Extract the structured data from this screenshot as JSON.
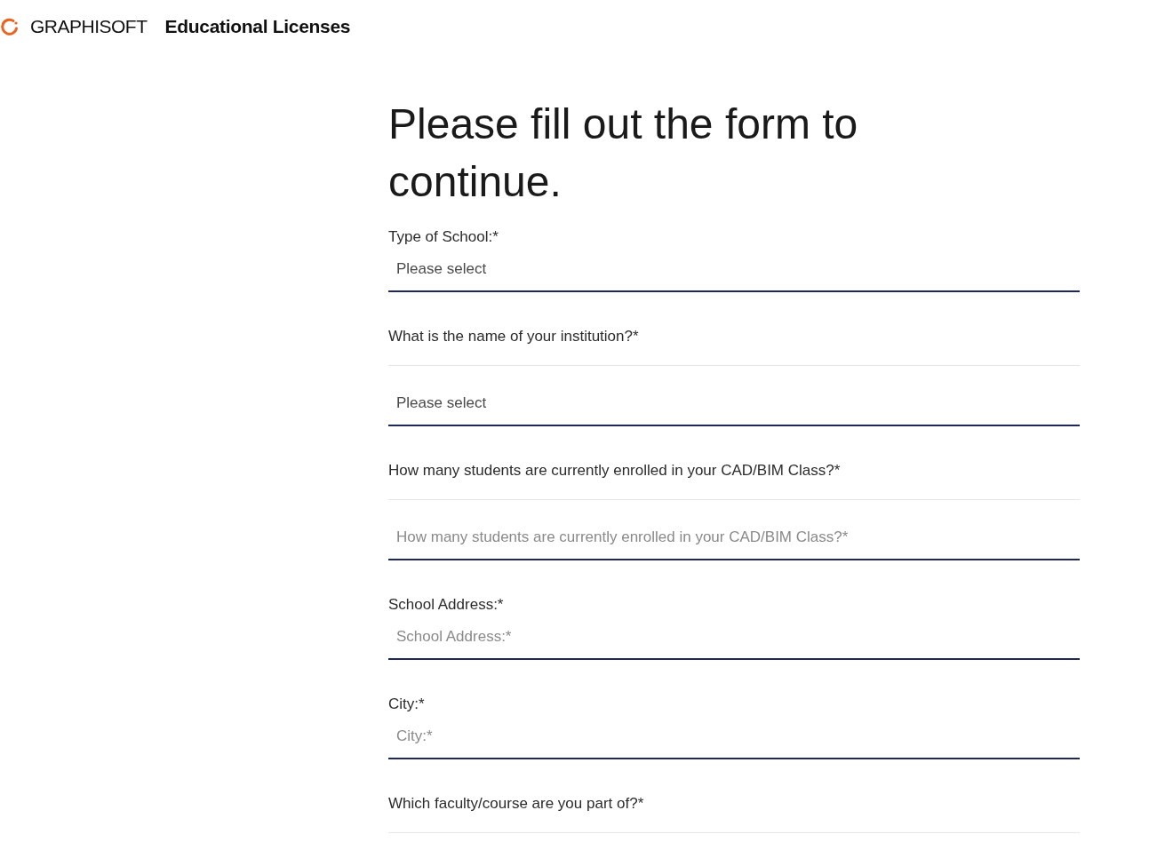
{
  "header": {
    "brand": "GRAPHISOFT",
    "title": "Educational Licenses"
  },
  "form": {
    "heading": "Please fill out the form to continue.",
    "fields": [
      {
        "label": "Type of School:*",
        "divider": false,
        "kind": "select",
        "value": "Please select"
      },
      {
        "label": "What is the name of your institution?*",
        "divider": true,
        "kind": "select",
        "value": "Please select"
      },
      {
        "label": "How many students are currently enrolled in your CAD/BIM Class?*",
        "divider": true,
        "kind": "text",
        "placeholder": "How many students are currently enrolled in your CAD/BIM Class?*"
      },
      {
        "label": "School Address:*",
        "divider": false,
        "kind": "text",
        "placeholder": "School Address:*"
      },
      {
        "label": "City:*",
        "divider": false,
        "kind": "text",
        "placeholder": "City:*"
      },
      {
        "label": "Which faculty/course are you part of?*",
        "divider": true
      }
    ]
  }
}
